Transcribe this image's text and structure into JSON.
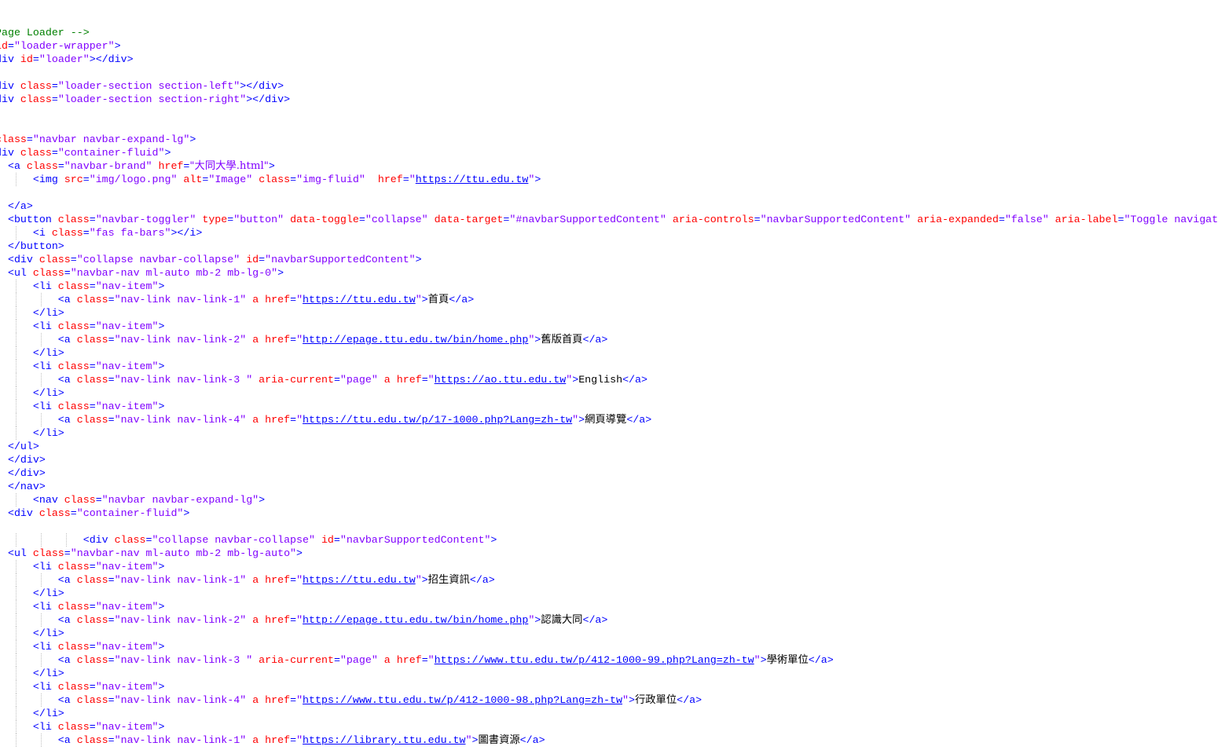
{
  "editor": {
    "colors": {
      "tag": "#0000ff",
      "attribute": "#ff0000",
      "value": "#8000ff",
      "comment": "#008000",
      "text": "#000000",
      "link": "#0000ff",
      "indent_guide": "#c0c0c0"
    },
    "lines": [
      [
        [
          "c",
          "Page Loader -->"
        ]
      ],
      [
        [
          "a",
          "id"
        ],
        [
          "t",
          "="
        ],
        [
          "v",
          "\"loader-wrapper\""
        ],
        [
          "t",
          ">"
        ]
      ],
      [
        [
          "t",
          "div "
        ],
        [
          "a",
          "id"
        ],
        [
          "t",
          "="
        ],
        [
          "v",
          "\"loader\""
        ],
        [
          "t",
          "></div>"
        ]
      ],
      [],
      [
        [
          "t",
          "div "
        ],
        [
          "a",
          "class"
        ],
        [
          "t",
          "="
        ],
        [
          "v",
          "\"loader-section section-left\""
        ],
        [
          "t",
          "></div>"
        ]
      ],
      [
        [
          "t",
          "div "
        ],
        [
          "a",
          "class"
        ],
        [
          "t",
          "="
        ],
        [
          "v",
          "\"loader-section section-right\""
        ],
        [
          "t",
          "></div>"
        ]
      ],
      [],
      [
        [
          "t",
          "."
        ]
      ],
      [
        [
          "a",
          "class"
        ],
        [
          "t",
          "="
        ],
        [
          "v",
          "\"navbar navbar-expand-lg\""
        ],
        [
          "t",
          ">"
        ]
      ],
      [
        [
          "t",
          "div "
        ],
        [
          "a",
          "class"
        ],
        [
          "t",
          "="
        ],
        [
          "v",
          "\"container-fluid\""
        ],
        [
          "t",
          ">"
        ]
      ],
      [
        [
          "t",
          "  <a "
        ],
        [
          "a",
          "class"
        ],
        [
          "t",
          "="
        ],
        [
          "v",
          "\"navbar-brand\""
        ],
        [
          "t",
          " "
        ],
        [
          "a",
          "href"
        ],
        [
          "t",
          "="
        ],
        [
          "v",
          "\"大同大學.html\""
        ],
        [
          "t",
          ">"
        ]
      ],
      [
        [
          "t",
          "      <img "
        ],
        [
          "a",
          "src"
        ],
        [
          "t",
          "="
        ],
        [
          "v",
          "\"img/logo.png\""
        ],
        [
          "t",
          " "
        ],
        [
          "a",
          "alt"
        ],
        [
          "t",
          "="
        ],
        [
          "v",
          "\"Image\""
        ],
        [
          "t",
          " "
        ],
        [
          "a",
          "class"
        ],
        [
          "t",
          "="
        ],
        [
          "v",
          "\"img-fluid\""
        ],
        [
          "t",
          "  "
        ],
        [
          "a",
          "href"
        ],
        [
          "t",
          "="
        ],
        [
          "v",
          "\""
        ],
        [
          "u",
          "https://ttu.edu.tw"
        ],
        [
          "v",
          "\""
        ],
        [
          "t",
          ">"
        ]
      ],
      [],
      [
        [
          "t",
          "  </a>"
        ]
      ],
      [
        [
          "t",
          "  <button "
        ],
        [
          "a",
          "class"
        ],
        [
          "t",
          "="
        ],
        [
          "v",
          "\"navbar-toggler\""
        ],
        [
          "t",
          " "
        ],
        [
          "a",
          "type"
        ],
        [
          "t",
          "="
        ],
        [
          "v",
          "\"button\""
        ],
        [
          "t",
          " "
        ],
        [
          "a",
          "data-toggle"
        ],
        [
          "t",
          "="
        ],
        [
          "v",
          "\"collapse\""
        ],
        [
          "t",
          " "
        ],
        [
          "a",
          "data-target"
        ],
        [
          "t",
          "="
        ],
        [
          "v",
          "\"#navbarSupportedContent\""
        ],
        [
          "t",
          " "
        ],
        [
          "a",
          "aria-controls"
        ],
        [
          "t",
          "="
        ],
        [
          "v",
          "\"navbarSupportedContent\""
        ],
        [
          "t",
          " "
        ],
        [
          "a",
          "aria-expanded"
        ],
        [
          "t",
          "="
        ],
        [
          "v",
          "\"false\""
        ],
        [
          "t",
          " "
        ],
        [
          "a",
          "aria-label"
        ],
        [
          "t",
          "="
        ],
        [
          "v",
          "\"Toggle navigation\""
        ],
        [
          "t",
          ">"
        ]
      ],
      [
        [
          "t",
          "      <i "
        ],
        [
          "a",
          "class"
        ],
        [
          "t",
          "="
        ],
        [
          "v",
          "\"fas fa-bars\""
        ],
        [
          "t",
          "></i>"
        ]
      ],
      [
        [
          "t",
          "  </button>"
        ]
      ],
      [
        [
          "t",
          "  <div "
        ],
        [
          "a",
          "class"
        ],
        [
          "t",
          "="
        ],
        [
          "v",
          "\"collapse navbar-collapse\""
        ],
        [
          "t",
          " "
        ],
        [
          "a",
          "id"
        ],
        [
          "t",
          "="
        ],
        [
          "v",
          "\"navbarSupportedContent\""
        ],
        [
          "t",
          ">"
        ]
      ],
      [
        [
          "t",
          "  <ul "
        ],
        [
          "a",
          "class"
        ],
        [
          "t",
          "="
        ],
        [
          "v",
          "\"navbar-nav ml-auto mb-2 mb-lg-0\""
        ],
        [
          "t",
          ">"
        ]
      ],
      [
        [
          "t",
          "      <li "
        ],
        [
          "a",
          "class"
        ],
        [
          "t",
          "="
        ],
        [
          "v",
          "\"nav-item\""
        ],
        [
          "t",
          ">"
        ]
      ],
      [
        [
          "t",
          "          <a "
        ],
        [
          "a",
          "class"
        ],
        [
          "t",
          "="
        ],
        [
          "v",
          "\"nav-link nav-link-1\""
        ],
        [
          "t",
          " "
        ],
        [
          "a",
          "a href"
        ],
        [
          "t",
          "="
        ],
        [
          "v",
          "\""
        ],
        [
          "u",
          "https://ttu.edu.tw"
        ],
        [
          "v",
          "\""
        ],
        [
          "t",
          ">"
        ],
        [
          "tx",
          "首頁"
        ],
        [
          "t",
          "</a>"
        ]
      ],
      [
        [
          "t",
          "      </li>"
        ]
      ],
      [
        [
          "t",
          "      <li "
        ],
        [
          "a",
          "class"
        ],
        [
          "t",
          "="
        ],
        [
          "v",
          "\"nav-item\""
        ],
        [
          "t",
          ">"
        ]
      ],
      [
        [
          "t",
          "          <a "
        ],
        [
          "a",
          "class"
        ],
        [
          "t",
          "="
        ],
        [
          "v",
          "\"nav-link nav-link-2\""
        ],
        [
          "t",
          " "
        ],
        [
          "a",
          "a href"
        ],
        [
          "t",
          "="
        ],
        [
          "v",
          "\""
        ],
        [
          "u",
          "http://epage.ttu.edu.tw/bin/home.php"
        ],
        [
          "v",
          "\""
        ],
        [
          "t",
          ">"
        ],
        [
          "tx",
          "舊版首頁"
        ],
        [
          "t",
          "</a>"
        ]
      ],
      [
        [
          "t",
          "      </li>"
        ]
      ],
      [
        [
          "t",
          "      <li "
        ],
        [
          "a",
          "class"
        ],
        [
          "t",
          "="
        ],
        [
          "v",
          "\"nav-item\""
        ],
        [
          "t",
          ">"
        ]
      ],
      [
        [
          "t",
          "          <a "
        ],
        [
          "a",
          "class"
        ],
        [
          "t",
          "="
        ],
        [
          "v",
          "\"nav-link nav-link-3 \""
        ],
        [
          "t",
          " "
        ],
        [
          "a",
          "aria-current"
        ],
        [
          "t",
          "="
        ],
        [
          "v",
          "\"page\""
        ],
        [
          "t",
          " "
        ],
        [
          "a",
          "a href"
        ],
        [
          "t",
          "="
        ],
        [
          "v",
          "\""
        ],
        [
          "u",
          "https://ao.ttu.edu.tw"
        ],
        [
          "v",
          "\""
        ],
        [
          "t",
          ">"
        ],
        [
          "tx",
          "English"
        ],
        [
          "t",
          "</a>"
        ]
      ],
      [
        [
          "t",
          "      </li>"
        ]
      ],
      [
        [
          "t",
          "      <li "
        ],
        [
          "a",
          "class"
        ],
        [
          "t",
          "="
        ],
        [
          "v",
          "\"nav-item\""
        ],
        [
          "t",
          ">"
        ]
      ],
      [
        [
          "t",
          "          <a "
        ],
        [
          "a",
          "class"
        ],
        [
          "t",
          "="
        ],
        [
          "v",
          "\"nav-link nav-link-4\""
        ],
        [
          "t",
          " "
        ],
        [
          "a",
          "a href"
        ],
        [
          "t",
          "="
        ],
        [
          "v",
          "\""
        ],
        [
          "u",
          "https://ttu.edu.tw/p/17-1000.php?Lang=zh-tw"
        ],
        [
          "v",
          "\""
        ],
        [
          "t",
          ">"
        ],
        [
          "tx",
          "網頁導覽"
        ],
        [
          "t",
          "</a>"
        ]
      ],
      [
        [
          "t",
          "      </li>"
        ]
      ],
      [
        [
          "t",
          "  </ul>"
        ]
      ],
      [
        [
          "t",
          "  </div>"
        ]
      ],
      [
        [
          "t",
          "  </div>"
        ]
      ],
      [
        [
          "t",
          "  </nav>"
        ]
      ],
      [
        [
          "t",
          "      <nav "
        ],
        [
          "a",
          "class"
        ],
        [
          "t",
          "="
        ],
        [
          "v",
          "\"navbar navbar-expand-lg\""
        ],
        [
          "t",
          ">"
        ]
      ],
      [
        [
          "t",
          "  <div "
        ],
        [
          "a",
          "class"
        ],
        [
          "t",
          "="
        ],
        [
          "v",
          "\"container-fluid\""
        ],
        [
          "t",
          ">"
        ]
      ],
      [],
      [
        [
          "t",
          "              <div "
        ],
        [
          "a",
          "class"
        ],
        [
          "t",
          "="
        ],
        [
          "v",
          "\"collapse navbar-collapse\""
        ],
        [
          "t",
          " "
        ],
        [
          "a",
          "id"
        ],
        [
          "t",
          "="
        ],
        [
          "v",
          "\"navbarSupportedContent\""
        ],
        [
          "t",
          ">"
        ]
      ],
      [
        [
          "t",
          "  <ul "
        ],
        [
          "a",
          "class"
        ],
        [
          "t",
          "="
        ],
        [
          "v",
          "\"navbar-nav ml-auto mb-2 mb-lg-auto\""
        ],
        [
          "t",
          ">"
        ]
      ],
      [
        [
          "t",
          "      <li "
        ],
        [
          "a",
          "class"
        ],
        [
          "t",
          "="
        ],
        [
          "v",
          "\"nav-item\""
        ],
        [
          "t",
          ">"
        ]
      ],
      [
        [
          "t",
          "          <a "
        ],
        [
          "a",
          "class"
        ],
        [
          "t",
          "="
        ],
        [
          "v",
          "\"nav-link nav-link-1\""
        ],
        [
          "t",
          " "
        ],
        [
          "a",
          "a href"
        ],
        [
          "t",
          "="
        ],
        [
          "v",
          "\""
        ],
        [
          "u",
          "https://ttu.edu.tw"
        ],
        [
          "v",
          "\""
        ],
        [
          "t",
          ">"
        ],
        [
          "tx",
          "招生資訊"
        ],
        [
          "t",
          "</a>"
        ]
      ],
      [
        [
          "t",
          "      </li>"
        ]
      ],
      [
        [
          "t",
          "      <li "
        ],
        [
          "a",
          "class"
        ],
        [
          "t",
          "="
        ],
        [
          "v",
          "\"nav-item\""
        ],
        [
          "t",
          ">"
        ]
      ],
      [
        [
          "t",
          "          <a "
        ],
        [
          "a",
          "class"
        ],
        [
          "t",
          "="
        ],
        [
          "v",
          "\"nav-link nav-link-2\""
        ],
        [
          "t",
          " "
        ],
        [
          "a",
          "a href"
        ],
        [
          "t",
          "="
        ],
        [
          "v",
          "\""
        ],
        [
          "u",
          "http://epage.ttu.edu.tw/bin/home.php"
        ],
        [
          "v",
          "\""
        ],
        [
          "t",
          ">"
        ],
        [
          "tx",
          "認識大同"
        ],
        [
          "t",
          "</a>"
        ]
      ],
      [
        [
          "t",
          "      </li>"
        ]
      ],
      [
        [
          "t",
          "      <li "
        ],
        [
          "a",
          "class"
        ],
        [
          "t",
          "="
        ],
        [
          "v",
          "\"nav-item\""
        ],
        [
          "t",
          ">"
        ]
      ],
      [
        [
          "t",
          "          <a "
        ],
        [
          "a",
          "class"
        ],
        [
          "t",
          "="
        ],
        [
          "v",
          "\"nav-link nav-link-3 \""
        ],
        [
          "t",
          " "
        ],
        [
          "a",
          "aria-current"
        ],
        [
          "t",
          "="
        ],
        [
          "v",
          "\"page\""
        ],
        [
          "t",
          " "
        ],
        [
          "a",
          "a href"
        ],
        [
          "t",
          "="
        ],
        [
          "v",
          "\""
        ],
        [
          "u",
          "https://www.ttu.edu.tw/p/412-1000-99.php?Lang=zh-tw"
        ],
        [
          "v",
          "\""
        ],
        [
          "t",
          ">"
        ],
        [
          "tx",
          "學術單位"
        ],
        [
          "t",
          "</a>"
        ]
      ],
      [
        [
          "t",
          "      </li>"
        ]
      ],
      [
        [
          "t",
          "      <li "
        ],
        [
          "a",
          "class"
        ],
        [
          "t",
          "="
        ],
        [
          "v",
          "\"nav-item\""
        ],
        [
          "t",
          ">"
        ]
      ],
      [
        [
          "t",
          "          <a "
        ],
        [
          "a",
          "class"
        ],
        [
          "t",
          "="
        ],
        [
          "v",
          "\"nav-link nav-link-4\""
        ],
        [
          "t",
          " "
        ],
        [
          "a",
          "a href"
        ],
        [
          "t",
          "="
        ],
        [
          "v",
          "\""
        ],
        [
          "u",
          "https://www.ttu.edu.tw/p/412-1000-98.php?Lang=zh-tw"
        ],
        [
          "v",
          "\""
        ],
        [
          "t",
          ">"
        ],
        [
          "tx",
          "行政單位"
        ],
        [
          "t",
          "</a>"
        ]
      ],
      [
        [
          "t",
          "      </li>"
        ]
      ],
      [
        [
          "t",
          "      <li "
        ],
        [
          "a",
          "class"
        ],
        [
          "t",
          "="
        ],
        [
          "v",
          "\"nav-item\""
        ],
        [
          "t",
          ">"
        ]
      ],
      [
        [
          "t",
          "          <a "
        ],
        [
          "a",
          "class"
        ],
        [
          "t",
          "="
        ],
        [
          "v",
          "\"nav-link nav-link-1\""
        ],
        [
          "t",
          " "
        ],
        [
          "a",
          "a href"
        ],
        [
          "t",
          "="
        ],
        [
          "v",
          "\""
        ],
        [
          "u",
          "https://library.ttu.edu.tw"
        ],
        [
          "v",
          "\""
        ],
        [
          "t",
          ">"
        ],
        [
          "tx",
          "圖書資源"
        ],
        [
          "t",
          "</a>"
        ]
      ]
    ]
  }
}
